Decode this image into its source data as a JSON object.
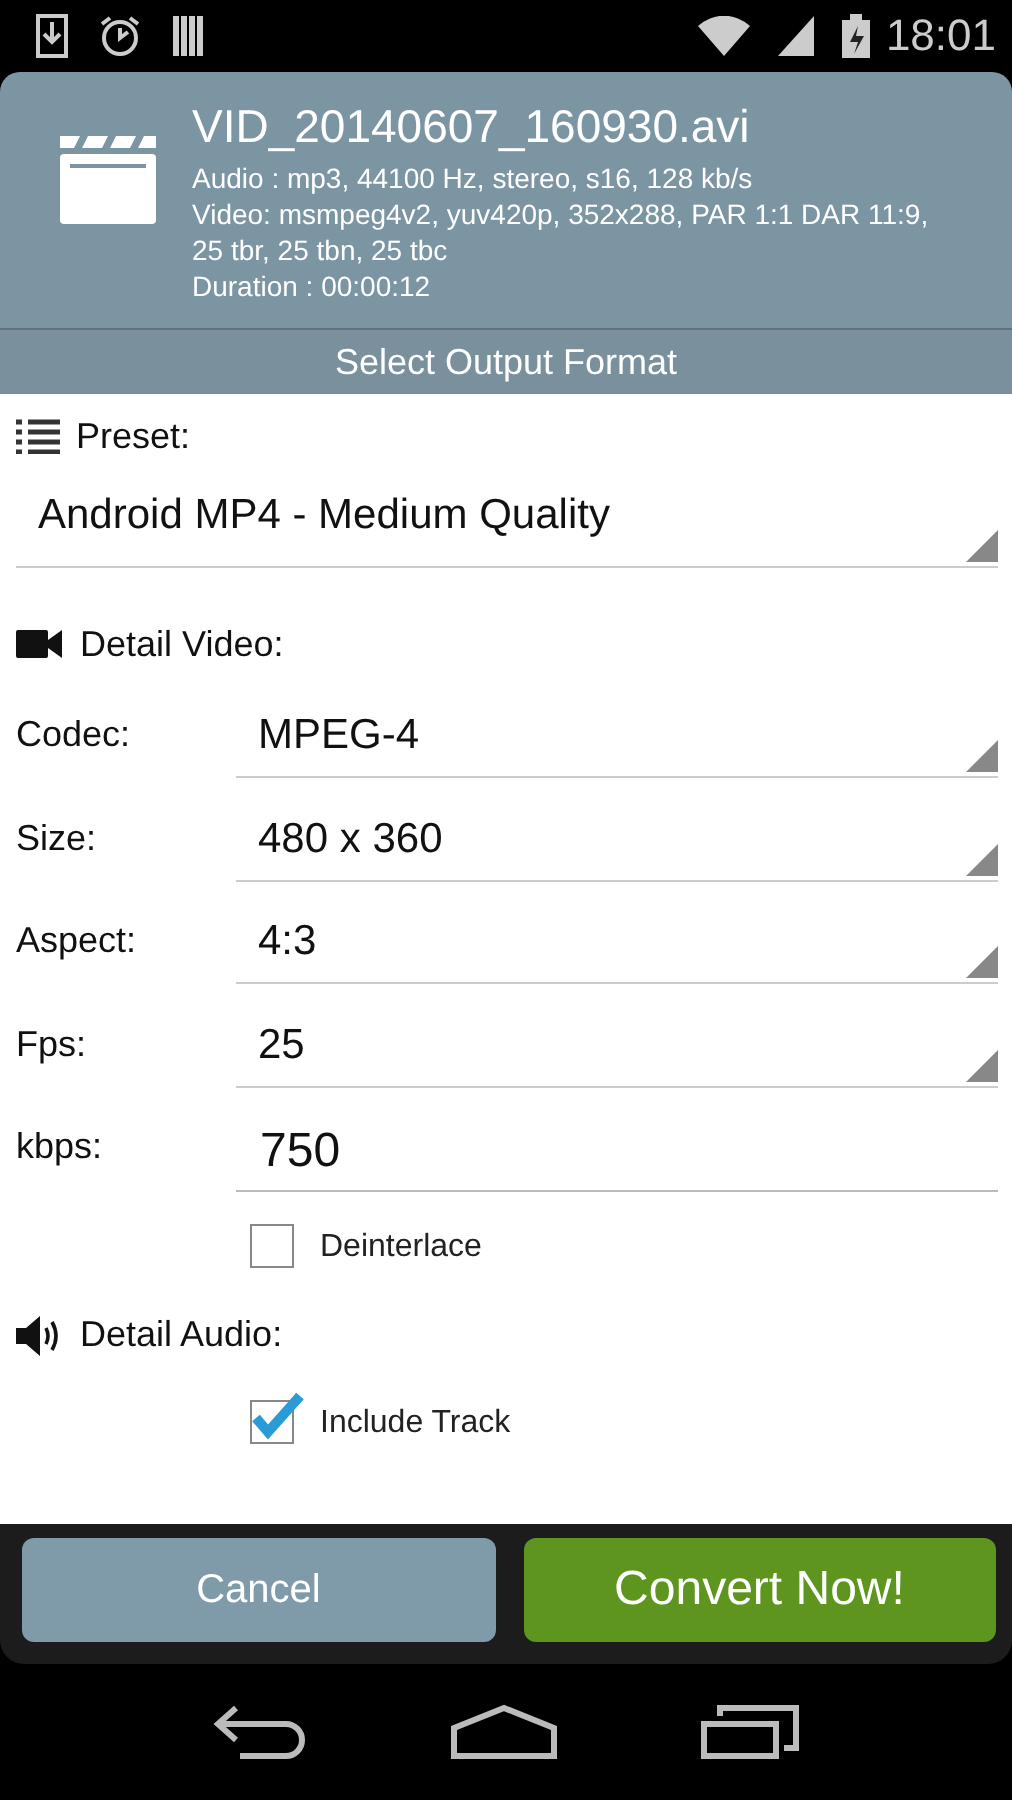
{
  "status_bar": {
    "time": "18:01"
  },
  "file": {
    "name": "VID_20140607_160930.avi",
    "audio": "Audio : mp3, 44100 Hz, stereo, s16, 128 kb/s",
    "video": "Video: msmpeg4v2, yuv420p, 352x288, PAR 1:1 DAR 11:9, 25 tbr, 25 tbn, 25 tbc",
    "duration": "Duration : 00:00:12"
  },
  "section_title": "Select Output Format",
  "preset": {
    "label": "Preset:",
    "value": "Android MP4 - Medium Quality"
  },
  "video": {
    "label": "Detail Video:",
    "fields": [
      {
        "label": "Codec:",
        "kind": "dropdown",
        "value": "MPEG-4"
      },
      {
        "label": "Size:",
        "kind": "dropdown",
        "value": "480 x 360"
      },
      {
        "label": "Aspect:",
        "kind": "dropdown",
        "value": "4:3"
      },
      {
        "label": "Fps:",
        "kind": "dropdown",
        "value": "25"
      },
      {
        "label": "kbps:",
        "kind": "input",
        "value": "750"
      }
    ],
    "deinterlace": {
      "label": "Deinterlace",
      "checked": false
    }
  },
  "audio": {
    "label": "Detail Audio:",
    "include_track": {
      "label": "Include Track",
      "checked": true
    }
  },
  "buttons": {
    "cancel": "Cancel",
    "convert": "Convert Now!"
  }
}
